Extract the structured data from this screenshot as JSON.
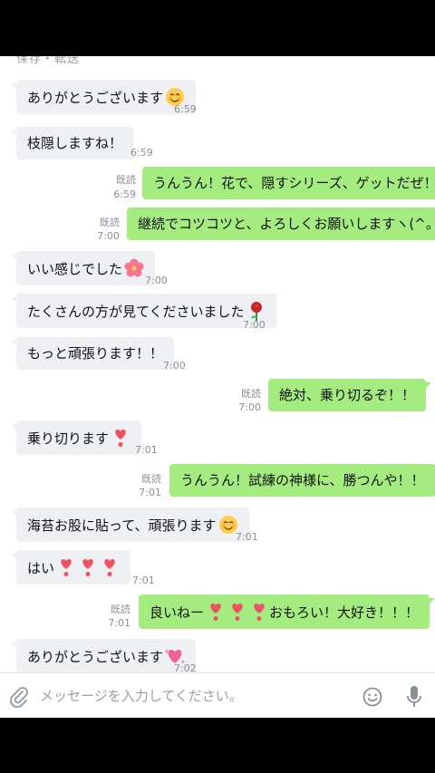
{
  "header_partial": "保存・転送",
  "messages": [
    {
      "dir": "in",
      "text": "ありがとうございます",
      "emoji": [
        "blush"
      ],
      "time": "6:59",
      "read": ""
    },
    {
      "dir": "in",
      "text": "枝隠しますね！",
      "emoji": [],
      "time": "6:59",
      "read": ""
    },
    {
      "dir": "out",
      "text": "うんうん！花で、隠すシリーズ、ゲットだぜ！！",
      "emoji": [],
      "time": "6:59",
      "read": "既読"
    },
    {
      "dir": "out",
      "text": "継続でコツコツと、よろしくお願いしますヽ(^。^)ノ",
      "emoji": [],
      "time": "7:00",
      "read": "既読"
    },
    {
      "dir": "in",
      "text": "いい感じでした",
      "emoji": [
        "hibiscus"
      ],
      "time": "7:00",
      "read": ""
    },
    {
      "dir": "in",
      "text": "たくさんの方が見てくださいました",
      "emoji": [
        "rose"
      ],
      "time": "7:00",
      "read": ""
    },
    {
      "dir": "in",
      "text": "もっと頑張ります！！",
      "emoji": [],
      "time": "7:00",
      "read": ""
    },
    {
      "dir": "out",
      "text": "絶対、乗り切るぞ！！",
      "emoji": [],
      "time": "7:00",
      "read": "既読"
    },
    {
      "dir": "in",
      "text": "乗り切ります",
      "emoji": [
        "heart-exclamation"
      ],
      "time": "7:01",
      "read": ""
    },
    {
      "dir": "out",
      "text": "うんうん！試練の神様に、勝つんや！！",
      "emoji": [],
      "time": "7:01",
      "read": "既読"
    },
    {
      "dir": "in",
      "text": "海苔お股に貼って、頑張ります",
      "emoji": [
        "blush"
      ],
      "time": "7:01",
      "read": ""
    },
    {
      "dir": "in",
      "text": "はい",
      "emoji": [
        "heart-exclamation",
        "heart-exclamation",
        "heart-exclamation"
      ],
      "time": "7:01",
      "read": ""
    },
    {
      "dir": "out",
      "text": "良いねー",
      "text_after": "おもろい！大好き！！！",
      "emoji": [
        "heart-exclamation",
        "heart-exclamation",
        "heart-exclamation"
      ],
      "time": "7:01",
      "read": "既読"
    },
    {
      "dir": "in",
      "text": "ありがとうございます",
      "emoji": [
        "sparkling-heart"
      ],
      "time": "7:02",
      "read": ""
    }
  ],
  "input": {
    "placeholder": "メッセージを入力してください。",
    "value": ""
  },
  "icons": {
    "attach": "paperclip-icon",
    "sticker": "smile-icon",
    "voice": "mic-icon"
  },
  "colors": {
    "outgoing_bubble": "#a4ec7f",
    "incoming_bubble": "#eef0f4",
    "background": "#ffffff"
  }
}
